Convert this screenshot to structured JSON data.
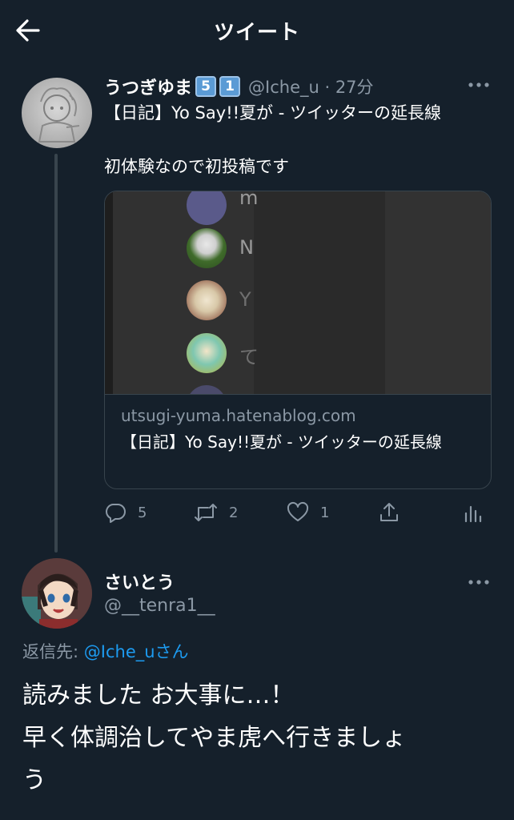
{
  "header": {
    "title": "ツイート"
  },
  "tweet1": {
    "name": "うつぎゆま",
    "badges": [
      "5",
      "1"
    ],
    "handle_time": "@Iche_u · 27分",
    "text_line1": "【日記】Yo Say!!夏が - ツイッターの延長線",
    "text_line2": "初体験なので初投稿です",
    "card": {
      "preview_letters": [
        "m",
        "N",
        "Y",
        "て"
      ],
      "domain": "utsugi-yuma.hatenablog.com",
      "title": "【日記】Yo Say!!夏が - ツイッターの延長線"
    },
    "actions": {
      "reply_count": "5",
      "retweet_count": "2",
      "like_count": "1"
    }
  },
  "tweet2": {
    "name": "さいとう",
    "handle": "@__tenra1__",
    "reply_prefix": "返信先: ",
    "reply_mention": "@Iche_u",
    "reply_suffix": "さん",
    "text_line1": "読みました お大事に…！",
    "text_line2": "早く体調治してやま虎へ行きましょ",
    "text_line3": "う"
  },
  "colors": {
    "background": "#15202b",
    "secondary_text": "#8b98a5",
    "link": "#1d9bf0",
    "border": "#38444d"
  },
  "icons": [
    "back-arrow-icon",
    "more-icon",
    "reply-icon",
    "retweet-icon",
    "like-icon",
    "share-icon",
    "analytics-icon"
  ]
}
